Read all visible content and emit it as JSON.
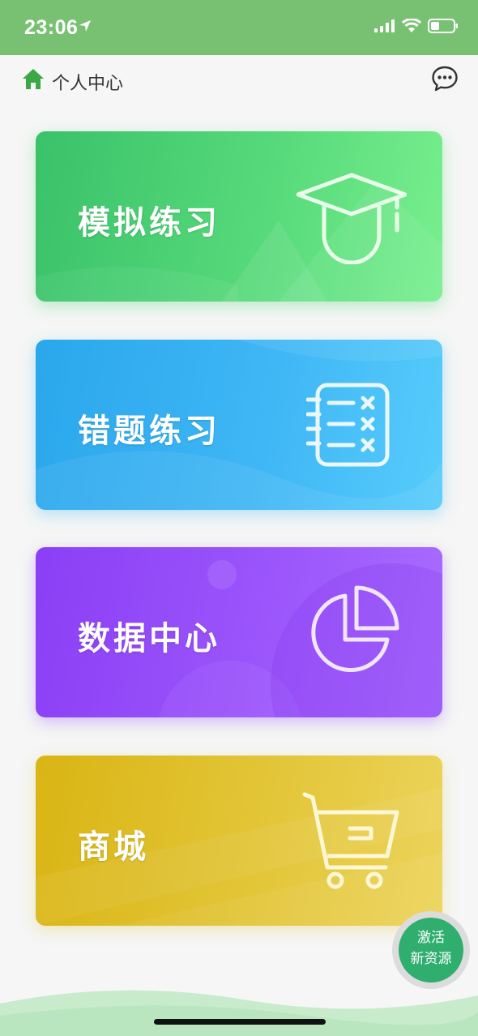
{
  "status_bar": {
    "time": "23:06"
  },
  "header": {
    "title": "个人中心"
  },
  "cards": [
    {
      "label": "模拟练习",
      "icon": "graduation-cap-icon",
      "color": "#3ac26a"
    },
    {
      "label": "错题练习",
      "icon": "wrong-questions-list-icon",
      "color": "#2aa7ec"
    },
    {
      "label": "数据中心",
      "icon": "pie-chart-icon",
      "color": "#8b3ff5"
    },
    {
      "label": "商城",
      "icon": "shopping-cart-icon",
      "color": "#d9b514"
    }
  ],
  "fab": {
    "line1": "激活",
    "line2": "新资源",
    "color": "#2fae6e"
  },
  "colors": {
    "status_bar": "#79c172",
    "home_icon": "#3aa845"
  }
}
